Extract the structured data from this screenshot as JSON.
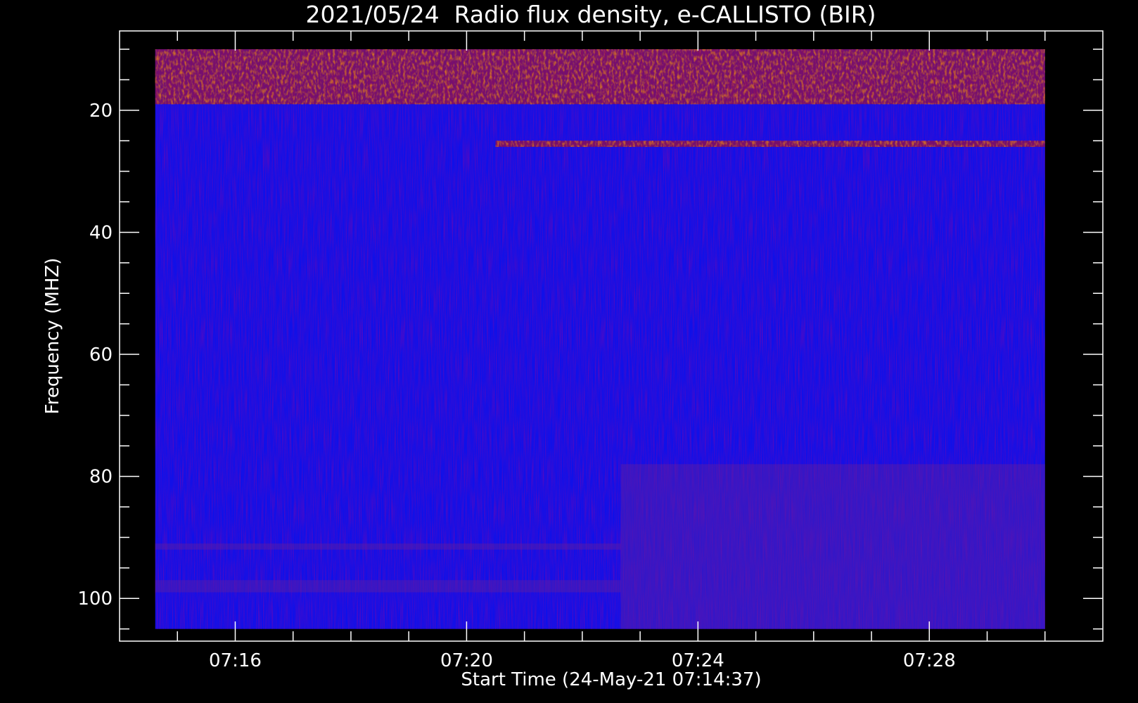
{
  "chart_data": {
    "type": "heatmap",
    "title": "2021/05/24  Radio flux density, e-CALLISTO (BIR)",
    "xlabel": "Start Time (24-May-21 07:14:37)",
    "ylabel": "Frequency (MHZ)",
    "x_range": [
      "07:14:37",
      "07:30:00"
    ],
    "x_axis_range": [
      "07:14",
      "07:31"
    ],
    "y_range": [
      10,
      105
    ],
    "y_axis_range": [
      107,
      7
    ],
    "x_ticks": [
      "07:16",
      "07:20",
      "07:24",
      "07:28"
    ],
    "y_ticks": [
      20,
      40,
      60,
      80,
      100
    ],
    "colormap": [
      "#000000",
      "#0000ff",
      "#d00000",
      "#ff8000",
      "#ffff60"
    ],
    "background_level": "blue",
    "features": [
      {
        "freq_mhz": [
          10,
          19
        ],
        "time": [
          "07:14:37",
          "07:30:00"
        ],
        "level": "high",
        "note": "noisy interference band"
      },
      {
        "freq_mhz": [
          25,
          26
        ],
        "time": [
          "07:20:30",
          "07:30:00"
        ],
        "level": "high",
        "note": "periodic bright pulses"
      },
      {
        "freq_mhz": [
          91,
          92
        ],
        "time": [
          "07:14:37",
          "07:22:40"
        ],
        "level": "medium"
      },
      {
        "freq_mhz": [
          97,
          99
        ],
        "time": [
          "07:14:37",
          "07:22:40"
        ],
        "level": "medium"
      },
      {
        "freq_mhz": [
          78,
          105
        ],
        "time": [
          "07:22:40",
          "07:30:00"
        ],
        "level": "medium"
      }
    ]
  }
}
